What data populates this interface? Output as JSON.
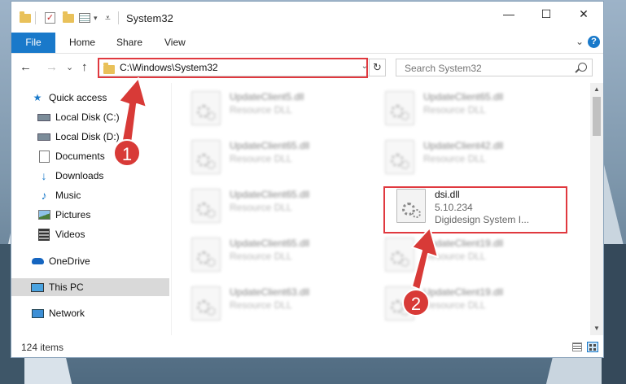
{
  "window": {
    "title": "System32",
    "controls": {
      "minimize": "—",
      "maximize": "☐",
      "close": "✕"
    }
  },
  "ribbon": {
    "tabs": [
      "File",
      "Home",
      "Share",
      "View"
    ],
    "expand": "⌄",
    "help": "?"
  },
  "nav": {
    "back": "←",
    "forward": "→",
    "recent": "⌄",
    "up": "↑",
    "address": "C:\\Windows\\System32",
    "address_dropdown": "⌄",
    "refresh": "↻",
    "search_placeholder": "Search System32"
  },
  "sidebar": {
    "items": [
      {
        "label": "Quick access",
        "icon": "star-icon",
        "pinned": false
      },
      {
        "label": "Local Disk (C:)",
        "icon": "drive-icon",
        "pinned": true
      },
      {
        "label": "Local Disk (D:)",
        "icon": "drive-icon",
        "pinned": true
      },
      {
        "label": "Documents",
        "icon": "documents-icon",
        "pinned": true
      },
      {
        "label": "Downloads",
        "icon": "downloads-icon",
        "pinned": true
      },
      {
        "label": "Music",
        "icon": "music-icon",
        "pinned": true
      },
      {
        "label": "Pictures",
        "icon": "pictures-icon",
        "pinned": true
      },
      {
        "label": "Videos",
        "icon": "videos-icon",
        "pinned": true
      },
      {
        "label": "OneDrive",
        "icon": "cloud-icon",
        "pinned": false
      },
      {
        "label": "This PC",
        "icon": "computer-icon",
        "pinned": false,
        "selected": true
      },
      {
        "label": "Network",
        "icon": "network-icon",
        "pinned": false
      }
    ],
    "pin_glyph": "📌"
  },
  "files": [
    {
      "name": "UpdateClient5.dll",
      "type": "Resource DLL",
      "blurred": true
    },
    {
      "name": "UpdateClient65.dll",
      "type": "Resource DLL",
      "blurred": true
    },
    {
      "name": "UpdateClient65.dll",
      "type": "Resource DLL",
      "blurred": true
    },
    {
      "name": "UpdateClient42.dll",
      "type": "Resource DLL",
      "blurred": true
    },
    {
      "name": "UpdateClient65.dll",
      "type": "Resource DLL",
      "blurred": true
    },
    {
      "name": "dsi.dll",
      "version": "5.10.234",
      "description": "Digidesign System I...",
      "blurred": false
    },
    {
      "name": "UpdateClient65.dll",
      "type": "Resource DLL",
      "blurred": true
    },
    {
      "name": "UpdateClient19.dll",
      "type": "Resource DLL",
      "blurred": true
    },
    {
      "name": "UpdateClient63.dll",
      "type": "Resource DLL",
      "blurred": true
    },
    {
      "name": "UpdateClient19.dll",
      "type": "Resource DLL",
      "blurred": true
    }
  ],
  "status": {
    "item_count": "124 items"
  },
  "callouts": {
    "step1": "1",
    "step2": "2"
  },
  "colors": {
    "accent": "#1979ca",
    "highlight": "#e0393f",
    "callout": "#d83a37"
  }
}
